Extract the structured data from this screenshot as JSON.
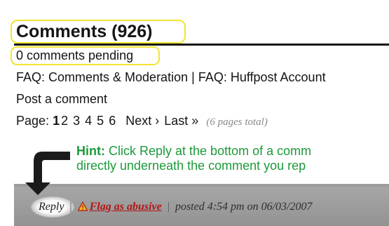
{
  "header": {
    "title": "Comments (926)",
    "pending": "0 comments pending"
  },
  "links": {
    "faq_moderation": "FAQ: Comments & Moderation",
    "faq_separator": "|",
    "faq_account": "FAQ: Huffpost Account",
    "post_comment": "Post a comment"
  },
  "pager": {
    "label": "Page:",
    "current": "1",
    "pages": [
      "2",
      "3",
      "4",
      "5",
      "6"
    ],
    "next": "Next ›",
    "last": "Last »",
    "total": "(6 pages total)"
  },
  "hint": {
    "prefix": "Hint:",
    "line1": "Click Reply at the bottom of a comm",
    "line2": "directly underneath the comment you rep"
  },
  "comment_footer": {
    "reply": "Reply",
    "separator": "|",
    "flag": "Flag as abusive",
    "posted": "posted 4:54 pm on 06/03/2007"
  },
  "colors": {
    "highlight": "#f2e433",
    "hint": "#1c9a3a",
    "flag": "#b31515",
    "bar": "#9c9c9c"
  },
  "icons": {
    "arrow": "curved-arrow-down-icon",
    "warning": "warning-icon"
  }
}
